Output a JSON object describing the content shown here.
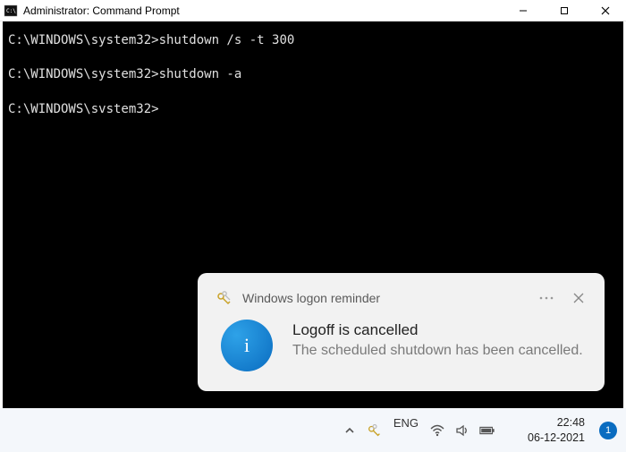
{
  "window": {
    "title": "Administrator: Command Prompt"
  },
  "terminal": {
    "lines": [
      {
        "prompt": "C:\\WINDOWS\\system32>",
        "command": "shutdown /s -t 300"
      },
      {
        "prompt": "C:\\WINDOWS\\system32>",
        "command": "shutdown -a"
      },
      {
        "prompt": "C:\\WINDOWS\\svstem32>",
        "command": ""
      }
    ]
  },
  "toast": {
    "app_name": "Windows logon reminder",
    "title": "Logoff is cancelled",
    "message": "The scheduled shutdown has been cancelled.",
    "info_glyph": "i"
  },
  "taskbar": {
    "language": "ENG",
    "time": "22:48",
    "date": "06-12-2021",
    "notification_count": "1"
  }
}
